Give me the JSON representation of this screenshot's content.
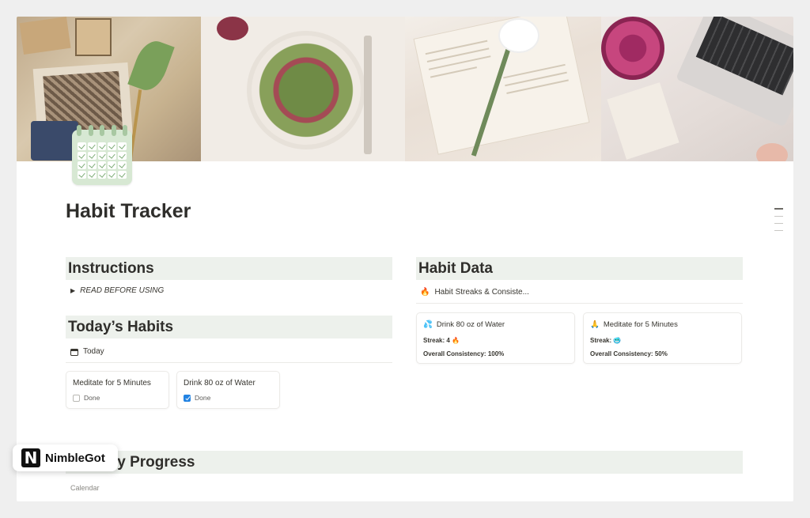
{
  "page": {
    "title": "Habit Tracker",
    "icon": "habit-calendar-icon"
  },
  "instructions": {
    "heading": "Instructions",
    "toggle_label": "READ BEFORE USING"
  },
  "todays_habits": {
    "heading": "Today’s Habits",
    "view_label": "Today",
    "view_icon": "calendar-icon",
    "cards": [
      {
        "title": "Meditate for 5 Minutes",
        "checkbox_label": "Done",
        "checked": false
      },
      {
        "title": "Drink 80 oz of Water",
        "checkbox_label": "Done",
        "checked": true
      }
    ]
  },
  "habit_data": {
    "heading": "Habit Data",
    "view_label": "Habit Streaks & Consiste...",
    "view_icon": "fire-icon",
    "cards": [
      {
        "emoji": "💦",
        "title": "Drink 80 oz of Water",
        "streak_label": "Streak:",
        "streak_value": "4",
        "streak_emoji": "🔥",
        "consistency_label": "Overall Consistency:",
        "consistency_value": "100%"
      },
      {
        "emoji": "🙏",
        "title": "Meditate for 5 Minutes",
        "streak_label": "Streak:",
        "streak_value": "",
        "streak_emoji": "🥶",
        "consistency_label": "Overall Consistency:",
        "consistency_value": "50%"
      }
    ]
  },
  "monthly_progress": {
    "heading": "Monthly Progress",
    "view_label": "Calendar"
  },
  "watermark": {
    "logo_letter": "N",
    "name": "NimbleGot"
  },
  "colors": {
    "heading_bg": "#edf1ec",
    "checkbox_checked": "#2383e2",
    "icon_green": "#d7e8d3"
  }
}
